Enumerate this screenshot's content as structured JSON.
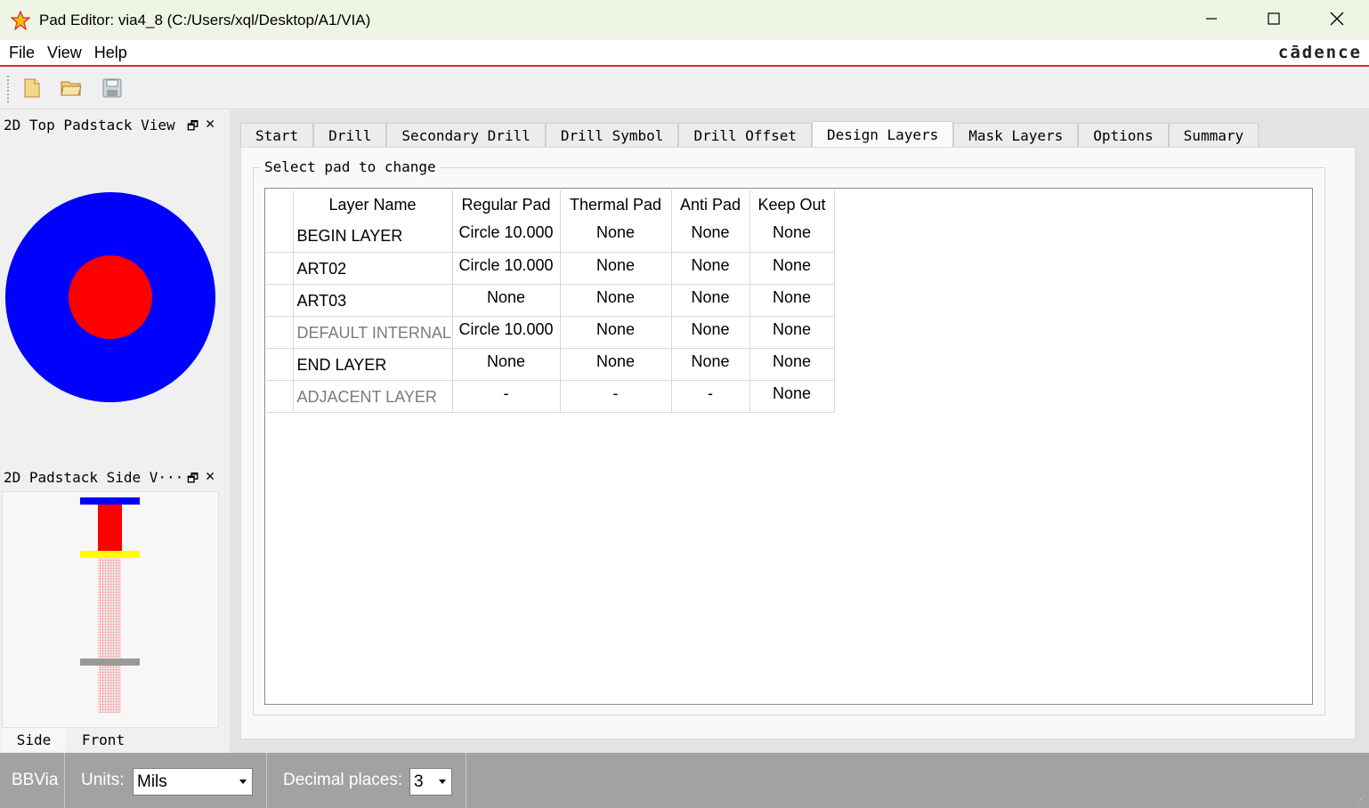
{
  "window": {
    "title": "Pad Editor: via4_8  (C:/Users/xql/Desktop/A1/VIA)",
    "icon": "pad-editor-icon"
  },
  "menu": {
    "items": [
      "File",
      "View",
      "Help"
    ],
    "brand": "cādence"
  },
  "toolbar": {
    "buttons": [
      "new-file-icon",
      "open-folder-icon",
      "save-icon"
    ]
  },
  "panels": {
    "top_view_title": "2D Top Padstack View",
    "side_view_title": "2D Padstack Side V···",
    "side_tabs": [
      "Side",
      "Front"
    ],
    "colors": {
      "antipad": "#0000ff",
      "regular": "#ff0000",
      "layer_mark": "#ffff00",
      "internal": "#999999"
    }
  },
  "tabs": {
    "items": [
      "Start",
      "Drill",
      "Secondary Drill",
      "Drill Symbol",
      "Drill Offset",
      "Design Layers",
      "Mask Layers",
      "Options",
      "Summary"
    ],
    "active": "Design Layers"
  },
  "design_layers": {
    "group_label": "Select pad to change",
    "columns": [
      "Layer Name",
      "Regular Pad",
      "Thermal Pad",
      "Anti Pad",
      "Keep Out"
    ],
    "rows": [
      {
        "layer": "BEGIN LAYER",
        "regular": "Circle 10.000",
        "thermal": "None",
        "anti": "None",
        "keepout": "None"
      },
      {
        "layer": "ART02",
        "regular": "Circle 10.000",
        "thermal": "None",
        "anti": "None",
        "keepout": "None"
      },
      {
        "layer": "ART03",
        "regular": "None",
        "thermal": "None",
        "anti": "None",
        "keepout": "None"
      },
      {
        "layer": "DEFAULT INTERNAL",
        "regular": "Circle 10.000",
        "thermal": "None",
        "anti": "None",
        "keepout": "None"
      },
      {
        "layer": "END LAYER",
        "regular": "None",
        "thermal": "None",
        "anti": "None",
        "keepout": "None"
      },
      {
        "layer": "ADJACENT LAYER",
        "regular": "-",
        "thermal": "-",
        "anti": "-",
        "keepout": "None"
      }
    ]
  },
  "status": {
    "type": "BBVia",
    "units_label": "Units:",
    "units_value": "Mils",
    "decimal_label": "Decimal places:",
    "decimal_value": "3"
  }
}
